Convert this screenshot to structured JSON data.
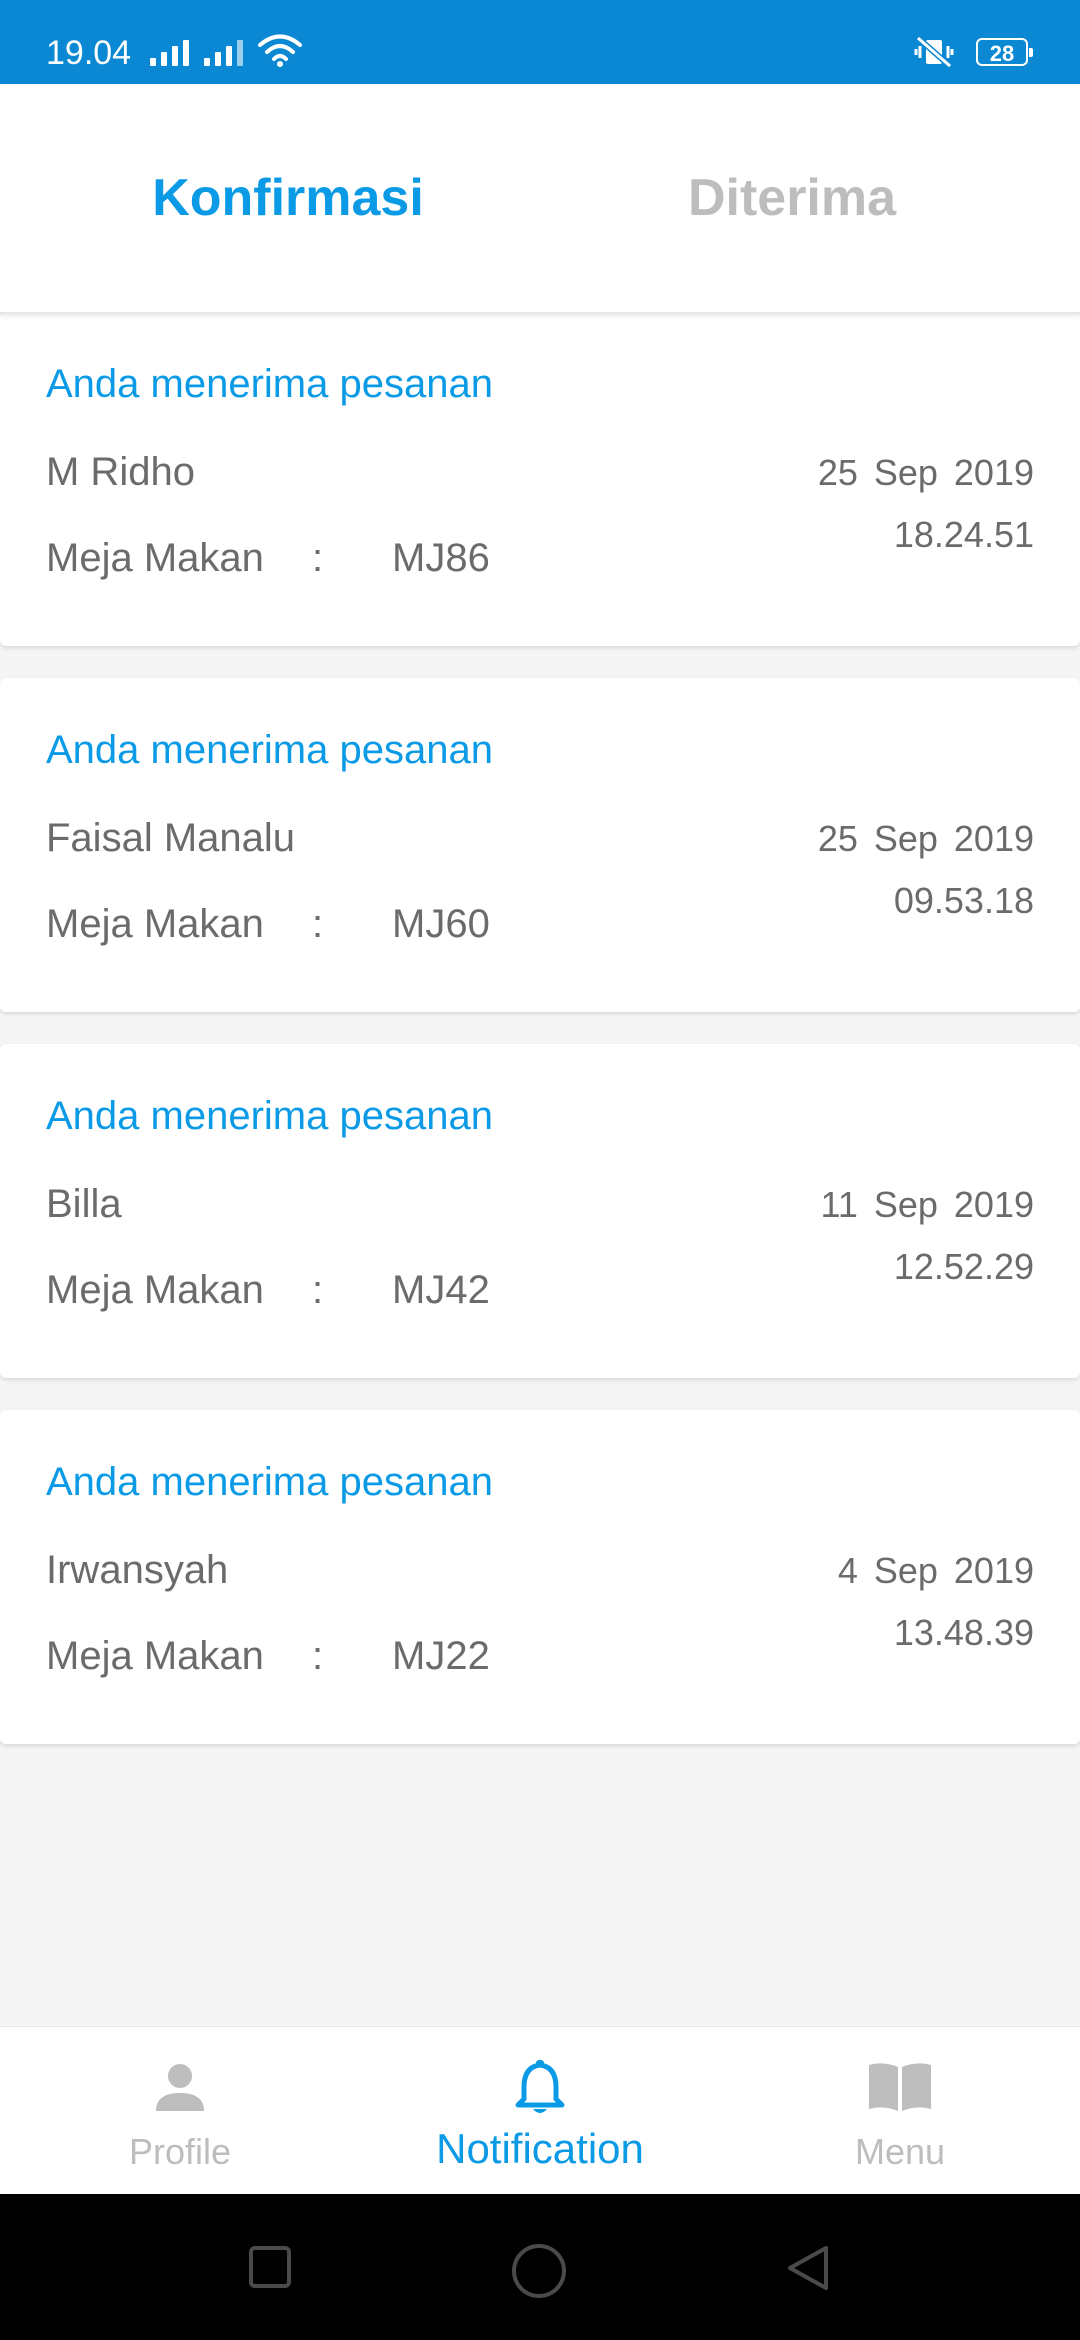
{
  "status_bar": {
    "time": "19.04",
    "battery": "28",
    "icons": [
      "signal-icon",
      "signal-icon",
      "wifi-icon",
      "vibrate-mute-icon",
      "battery-icon"
    ]
  },
  "tabs": [
    {
      "label": "Konfirmasi",
      "active": true
    },
    {
      "label": "Diterima",
      "active": false
    }
  ],
  "notifications": [
    {
      "title": "Anda menerima pesanan",
      "name": "M Ridho",
      "table_label": "Meja Makan",
      "colon": ":",
      "table_code": "MJ86",
      "date": "25 Sep 2019",
      "time": "18.24.51"
    },
    {
      "title": "Anda menerima pesanan",
      "name": "Faisal Manalu",
      "table_label": "Meja Makan",
      "colon": ":",
      "table_code": "MJ60",
      "date": "25 Sep 2019",
      "time": "09.53.18"
    },
    {
      "title": "Anda menerima pesanan",
      "name": "Billa",
      "table_label": "Meja Makan",
      "colon": ":",
      "table_code": "MJ42",
      "date": "11 Sep 2019",
      "time": "12.52.29"
    },
    {
      "title": "Anda menerima pesanan",
      "name": "Irwansyah",
      "table_label": "Meja Makan",
      "colon": ":",
      "table_code": "MJ22",
      "date": "4 Sep 2019",
      "time": "13.48.39"
    }
  ],
  "bottom_nav": [
    {
      "label": "Profile",
      "icon": "person-icon",
      "active": false
    },
    {
      "label": "Notification",
      "icon": "bell-icon",
      "active": true
    },
    {
      "label": "Menu",
      "icon": "book-icon",
      "active": false
    }
  ],
  "colors": {
    "status_bar": "#0a88d3",
    "accent": "#0b9be6",
    "inactive": "#bdbdbd",
    "text": "#6b6b6b",
    "background": "#f5f5f5"
  }
}
